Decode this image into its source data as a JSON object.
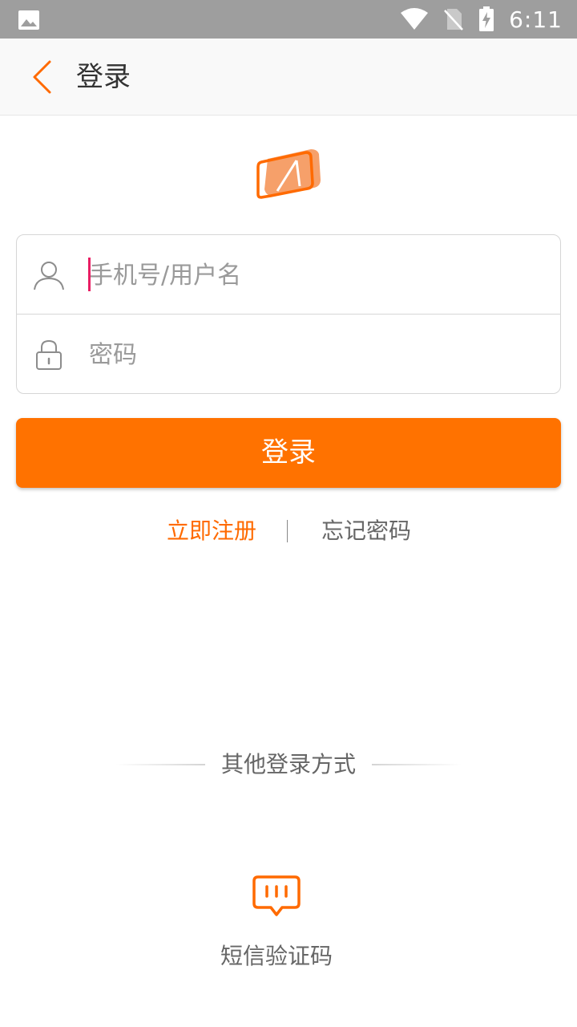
{
  "status_bar": {
    "time": "6:11",
    "icons": [
      "gallery-icon",
      "wifi-icon",
      "no-sim-icon",
      "battery-charging-icon"
    ]
  },
  "app_bar": {
    "title": "登录",
    "back_icon": "chevron-left-icon"
  },
  "logo": {
    "icon": "app-logo-icon"
  },
  "form": {
    "username": {
      "placeholder": "手机号/用户名",
      "value": "",
      "icon": "user-icon"
    },
    "password": {
      "placeholder": "密码",
      "value": "",
      "icon": "lock-icon"
    }
  },
  "login_button": {
    "label": "登录"
  },
  "links": {
    "register": "立即注册",
    "forgot_password": "忘记密码"
  },
  "other_login": {
    "title": "其他登录方式",
    "sms": {
      "label": "短信验证码",
      "icon": "sms-message-icon"
    }
  },
  "colors": {
    "accent": "#ff7200",
    "link_accent": "#ff6a00",
    "caret": "#e91e63",
    "status_bar": "#9e9e9e",
    "app_bar": "#f9f9f9"
  }
}
